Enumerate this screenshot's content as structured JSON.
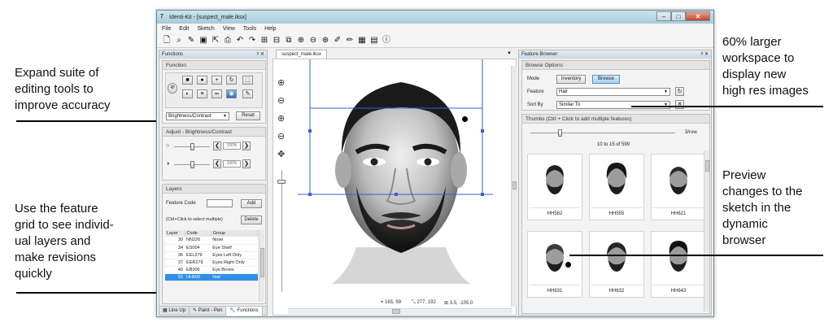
{
  "callouts": {
    "tools": [
      "Expand suite of",
      "editing tools to",
      "improve accuracy"
    ],
    "grid": [
      "Use the feature",
      "grid to see individ-",
      "ual layers and",
      "make revisions",
      "quickly"
    ],
    "workspace": [
      "60% larger",
      "workspace to",
      "display new",
      "high res images"
    ],
    "preview": [
      "Preview",
      "changes to the",
      "sketch in the",
      "dynamic",
      "browser"
    ]
  },
  "window": {
    "title": "Identi-Kit - [suspect_male.iksx]",
    "app_icon": "7",
    "min": "–",
    "max": "□",
    "close": "✕"
  },
  "menu": [
    "File",
    "Edit",
    "Sketch",
    "View",
    "Tools",
    "Help"
  ],
  "toolbar_icons": [
    "new-icon",
    "open-icon",
    "wand-icon",
    "save-icon",
    "export-icon",
    "print-icon",
    "undo-icon",
    "redo-icon",
    "add-feature-icon",
    "remove-feature-icon",
    "copy-icon",
    "zoom-fit-icon",
    "zoom-out-icon",
    "zoom-in-icon",
    "pen-icon",
    "brush-icon",
    "grid-icon",
    "layers-icon",
    "info-icon"
  ],
  "functions_panel": {
    "title": "Functions",
    "pin": "ᵖ ✕",
    "function_title": "Function",
    "mode_select": "Brightness/Contrast",
    "reset": "Reset",
    "adjust_title": "Adjust - Brightness/Contrast",
    "brightness": {
      "value": "100%",
      "level": 0.5
    },
    "contrast": {
      "value": "100%",
      "level": 0.5
    },
    "layers_title": "Layers",
    "feature_code_label": "Feature Code",
    "feature_code_value": "",
    "add": "Add",
    "hint": "(Ctrl+Click to select multiple)",
    "delete": "Delete",
    "table": {
      "headers": [
        "Layer",
        "Code",
        "Group"
      ],
      "rows": [
        {
          "layer": "30",
          "code": "NN226",
          "group": "Nose"
        },
        {
          "layer": "34",
          "code": "ES004",
          "group": "Eye Shelf"
        },
        {
          "layer": "36",
          "code": "EEL279",
          "group": "Eyes Left Only"
        },
        {
          "layer": "37",
          "code": "EER279",
          "group": "Eyes Right Only"
        },
        {
          "layer": "40",
          "code": "EB300",
          "group": "Eye Brows"
        },
        {
          "layer": "55",
          "code": "HH600",
          "group": "Hair"
        }
      ],
      "selected_index": 5
    },
    "bottom_tabs": [
      "Line Up",
      "Paint - Pen",
      "Functions"
    ]
  },
  "document": {
    "tab": "suspect_male.iksx",
    "status": {
      "cursor": "165, 99",
      "size": "277, 192",
      "offset": "3.5, -105.0"
    }
  },
  "feature_browser": {
    "title": "Feature Browser",
    "pin": "ᵖ ✕",
    "options_title": "Browse Options",
    "mode_label": "Mode",
    "mode_inventory": "Inventory",
    "mode_browse": "Browse",
    "feature_label": "Feature",
    "feature_value": "Hair",
    "sort_label": "Sort By",
    "sort_value": "Similar To",
    "thumbs_title": "Thumbs (Ctrl + Click to add multiple features)",
    "per_row": "3/row",
    "range": "10 to 15 of 599",
    "thumbs": [
      "HH582",
      "HH555",
      "HH621",
      "HH631",
      "HH632",
      "HH643"
    ]
  },
  "colors": {
    "accent": "#2f8fe8",
    "selection": "#3a5fd0"
  }
}
